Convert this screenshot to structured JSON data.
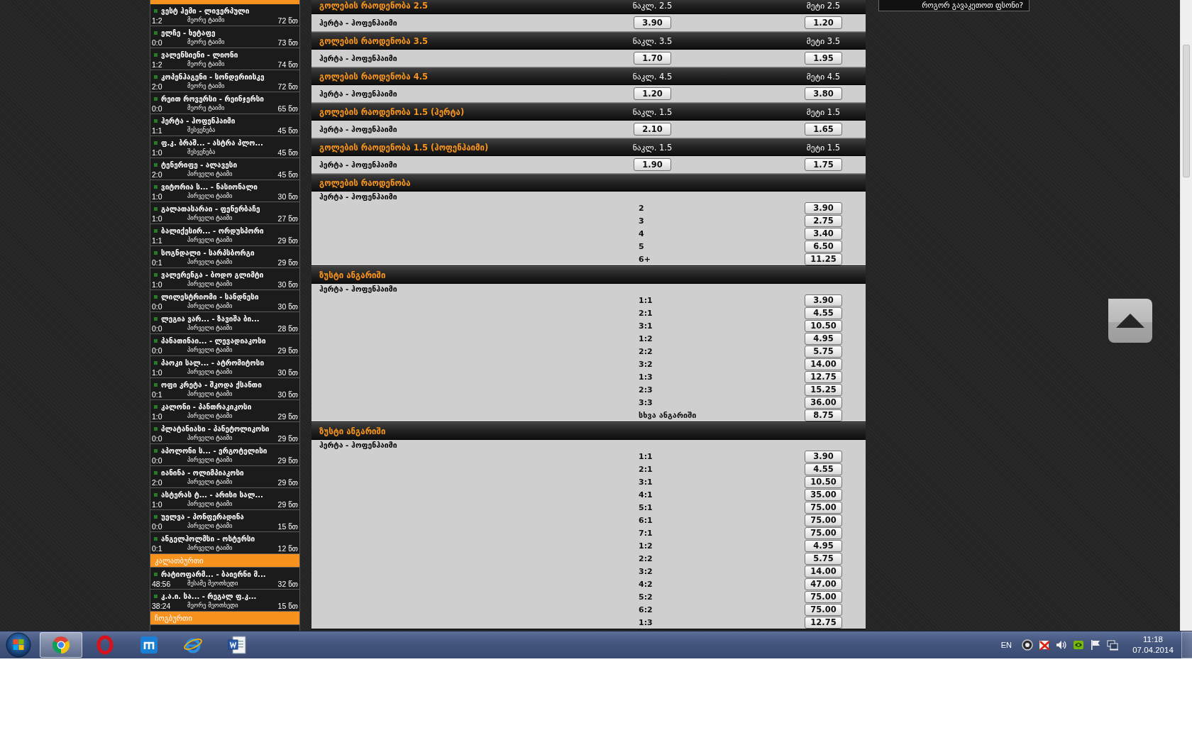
{
  "sidebar": {
    "sections": [
      {
        "matches": [
          {
            "teams": "ვესტ ჰემი - ლივერპული",
            "score": "1:2",
            "period": "მეორე ტაიმი",
            "time": "72 წთ"
          },
          {
            "teams": "ელჩე - ხეტაფე",
            "score": "0:0",
            "period": "მეორე ტაიმი",
            "time": "73 წთ"
          },
          {
            "teams": "ვალენსიენი - ლიონი",
            "score": "1:2",
            "period": "მეორე ტაიმი",
            "time": "74 წთ"
          },
          {
            "teams": "კოპენჰაგენი - სონდერიისკე",
            "score": "2:0",
            "period": "მეორე ტაიმი",
            "time": "72 წთ"
          },
          {
            "teams": "რეით როვერსი - რეინჯერსი",
            "score": "0:0",
            "period": "მეორე ტაიმი",
            "time": "65 წთ"
          },
          {
            "teams": "ჰერტა - ჰოფენჰაიმი",
            "score": "1:1",
            "period": "შესვენება",
            "time": "45 წთ"
          },
          {
            "teams": "ფ.კ. ბრაშ... - ასტრა პლო...",
            "score": "1:0",
            "period": "შესვენება",
            "time": "45 წთ"
          },
          {
            "teams": "ტენერიფე - ალავესი",
            "score": "2:0",
            "period": "პირველი ტაიმი",
            "time": "45 წთ"
          },
          {
            "teams": "ვიტორია ს... - ნასიონალი",
            "score": "1:0",
            "period": "პირველი ტაიმი",
            "time": "30 წთ"
          },
          {
            "teams": "გალათასარაი - ფენერბაჩე",
            "score": "1:0",
            "period": "პირველი ტაიმი",
            "time": "27 წთ"
          },
          {
            "teams": "ბალიქესირ... - ორდუსპორი",
            "score": "1:1",
            "period": "პირველი ტაიმი",
            "time": "29 წთ"
          },
          {
            "teams": "სოგნდალი - სარპსბორგი",
            "score": "0:1",
            "period": "პირველი ტაიმი",
            "time": "29 წთ"
          },
          {
            "teams": "ვალერენგა - ბოდო გლიმტი",
            "score": "1:0",
            "period": "პირველი ტაიმი",
            "time": "30 წთ"
          },
          {
            "teams": "ლილესტრიომი - სანდნესი",
            "score": "0:0",
            "period": "პირველი ტაიმი",
            "time": "30 წთ"
          },
          {
            "teams": "ლეგია ვარ... - ზავიშა ბი...",
            "score": "0:0",
            "period": "პირველი ტაიმი",
            "time": "28 წთ"
          },
          {
            "teams": "პანათინაი... - ლევადიაკოსი",
            "score": "0:0",
            "period": "პირველი ტაიმი",
            "time": "29 წთ"
          },
          {
            "teams": "პაოკი სალ... - ატრომიტოსი",
            "score": "1:0",
            "period": "პირველი ტაიმი",
            "time": "30 წთ"
          },
          {
            "teams": "ოფი კრეტა - შკოდა ქსანთი",
            "score": "0:1",
            "period": "პირველი ტაიმი",
            "time": "30 წთ"
          },
          {
            "teams": "კალონი - პანთრაკიკოსი",
            "score": "1:0",
            "period": "პირველი ტაიმი",
            "time": "29 წთ"
          },
          {
            "teams": "პლატანიასი - პანეტოლიკოსი",
            "score": "0:0",
            "period": "პირველი ტაიმი",
            "time": "29 წთ"
          },
          {
            "teams": "აპოლონი ს... - ერგოტელისი",
            "score": "0:0",
            "period": "პირველი ტაიმი",
            "time": "29 წთ"
          },
          {
            "teams": "იანინა - ოლიმპიაკოსი",
            "score": "2:0",
            "period": "პირველი ტაიმი",
            "time": "29 წთ"
          },
          {
            "teams": "ასტერას ტ... - არისი სალ...",
            "score": "1:0",
            "period": "პირველი ტაიმი",
            "time": "29 წთ"
          },
          {
            "teams": "უელვა - პონფერადინა",
            "score": "0:0",
            "period": "პირველი ტაიმი",
            "time": "15 წთ"
          },
          {
            "teams": "ანგელჰოლმსი - ოსტერსი",
            "score": "0:1",
            "period": "პირველი ტაიმი",
            "time": "12 წთ"
          }
        ]
      },
      {
        "title": "კალათბურთი",
        "matches": [
          {
            "teams": "რატიოფარმ... - ბაიერნი მ...",
            "score": "48:56",
            "period": "მესამე მეოთხედი",
            "time": "32 წთ"
          },
          {
            "teams": "კ.ა.ი. სა... - რეგალ ფ.კ...",
            "score": "38:24",
            "period": "მეორე მეოთხედი",
            "time": "15 წთ"
          }
        ]
      },
      {
        "title": "ჩოგბურთი"
      }
    ]
  },
  "markets": [
    {
      "kind": "pair",
      "title": "გოლების რაოდენობა 2.5",
      "labels": [
        "ნაკლ. 2.5",
        "მეტი 2.5"
      ],
      "event": "ჰერტა - ჰოფენჰაიმი",
      "odds": [
        "3.90",
        "1.20"
      ]
    },
    {
      "kind": "pair",
      "title": "გოლების რაოდენობა 3.5",
      "labels": [
        "ნაკლ. 3.5",
        "მეტი 3.5"
      ],
      "event": "ჰერტა - ჰოფენჰაიმი",
      "odds": [
        "1.70",
        "1.95"
      ]
    },
    {
      "kind": "pair",
      "title": "გოლების რაოდენობა 4.5",
      "labels": [
        "ნაკლ. 4.5",
        "მეტი 4.5"
      ],
      "event": "ჰერტა - ჰოფენჰაიმი",
      "odds": [
        "1.20",
        "3.80"
      ]
    },
    {
      "kind": "pair",
      "title": "გოლების რაოდენობა 1.5 (ჰერტა)",
      "labels": [
        "ნაკლ. 1.5",
        "მეტი 1.5"
      ],
      "event": "ჰერტა - ჰოფენჰაიმი",
      "odds": [
        "2.10",
        "1.65"
      ]
    },
    {
      "kind": "pair",
      "title": "გოლების რაოდენობა 1.5 (ჰოფენჰაიმი)",
      "labels": [
        "ნაკლ. 1.5",
        "მეტი 1.5"
      ],
      "event": "ჰერტა - ჰოფენჰაიმი",
      "odds": [
        "1.90",
        "1.75"
      ]
    },
    {
      "kind": "list",
      "title": "გოლების რაოდენობა",
      "event": "ჰერტა - ჰოფენჰაიმი",
      "options": [
        {
          "label": "2",
          "odds": "3.90"
        },
        {
          "label": "3",
          "odds": "2.75"
        },
        {
          "label": "4",
          "odds": "3.40"
        },
        {
          "label": "5",
          "odds": "6.50"
        },
        {
          "label": "6+",
          "odds": "11.25"
        }
      ]
    },
    {
      "kind": "list",
      "title": "ზუსტი ანგარიში",
      "event": "ჰერტა - ჰოფენჰაიმი",
      "options": [
        {
          "label": "1:1",
          "odds": "3.90"
        },
        {
          "label": "2:1",
          "odds": "4.55"
        },
        {
          "label": "3:1",
          "odds": "10.50"
        },
        {
          "label": "1:2",
          "odds": "4.95"
        },
        {
          "label": "2:2",
          "odds": "5.75"
        },
        {
          "label": "3:2",
          "odds": "14.00"
        },
        {
          "label": "1:3",
          "odds": "12.75"
        },
        {
          "label": "2:3",
          "odds": "15.25"
        },
        {
          "label": "3:3",
          "odds": "36.00"
        },
        {
          "label": "სხვა ანგარიში",
          "odds": "8.75"
        }
      ]
    },
    {
      "kind": "list",
      "title": "ზუსტი ანგარიში",
      "event": "ჰერტა - ჰოფენჰაიმი",
      "options": [
        {
          "label": "1:1",
          "odds": "3.90"
        },
        {
          "label": "2:1",
          "odds": "4.55"
        },
        {
          "label": "3:1",
          "odds": "10.50"
        },
        {
          "label": "4:1",
          "odds": "35.00"
        },
        {
          "label": "5:1",
          "odds": "75.00"
        },
        {
          "label": "6:1",
          "odds": "75.00"
        },
        {
          "label": "7:1",
          "odds": "75.00"
        },
        {
          "label": "1:2",
          "odds": "4.95"
        },
        {
          "label": "2:2",
          "odds": "5.75"
        },
        {
          "label": "3:2",
          "odds": "14.00"
        },
        {
          "label": "4:2",
          "odds": "47.00"
        },
        {
          "label": "5:2",
          "odds": "75.00"
        },
        {
          "label": "6:2",
          "odds": "75.00"
        },
        {
          "label": "1:3",
          "odds": "12.75"
        }
      ]
    }
  ],
  "help_box": {
    "text": "როგორ გავაკეთოთ ფსონი?"
  },
  "taskbar": {
    "apps": [
      {
        "kind": "wheel",
        "selected": true
      },
      {
        "kind": "ring",
        "selected": false
      },
      {
        "kind": "tile",
        "selected": false
      },
      {
        "kind": "orbit",
        "selected": false
      },
      {
        "kind": "document",
        "selected": false
      }
    ],
    "language": "EN",
    "time": "11:18",
    "date": "07.04.2014"
  }
}
